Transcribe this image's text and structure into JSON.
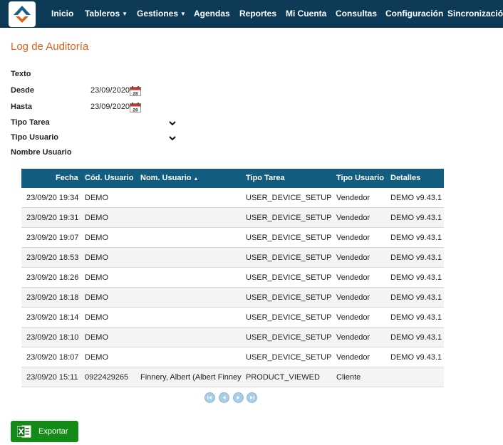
{
  "nav": {
    "items": [
      {
        "label": "Inicio",
        "dropdown": false
      },
      {
        "label": "Tableros",
        "dropdown": true
      },
      {
        "label": "Gestiones",
        "dropdown": true
      },
      {
        "label": "Agendas",
        "dropdown": false
      },
      {
        "label": "Reportes",
        "dropdown": false
      },
      {
        "label": "Mi Cuenta",
        "dropdown": false
      },
      {
        "label": "Consultas",
        "dropdown": false
      },
      {
        "label": "Configuración",
        "dropdown": false
      },
      {
        "label": "Sincronización",
        "dropdown": false
      }
    ],
    "caret": "▼",
    "bg_color": "#0d3a57"
  },
  "page": {
    "title": "Log de Auditoría"
  },
  "filters": {
    "texto_label": "Texto",
    "desde_label": "Desde",
    "desde_value": "23/09/2020",
    "hasta_label": "Hasta",
    "hasta_value": "23/09/2020",
    "tipo_tarea_label": "Tipo Tarea",
    "tipo_usuario_label": "Tipo Usuario",
    "nombre_usuario_label": "Nombre Usuario",
    "calendar_icon_day": "28"
  },
  "table": {
    "headers": {
      "fecha": "Fecha",
      "cod_usuario": "Cód. Usuario",
      "nom_usuario": "Nom. Usuario",
      "tipo_tarea": "Tipo Tarea",
      "tipo_usuario": "Tipo Usuario",
      "detalles": "Detalles"
    },
    "sort_indicator": "▲",
    "rows": [
      {
        "fecha": "23/09/20 19:34",
        "cod_usuario": "DEMO",
        "nom_usuario": "",
        "tipo_tarea": "USER_DEVICE_SETUP",
        "tipo_usuario": "Vendedor",
        "detalles": "DEMO v9.43.1"
      },
      {
        "fecha": "23/09/20 19:31",
        "cod_usuario": "DEMO",
        "nom_usuario": "",
        "tipo_tarea": "USER_DEVICE_SETUP",
        "tipo_usuario": "Vendedor",
        "detalles": "DEMO v9.43.1"
      },
      {
        "fecha": "23/09/20 19:07",
        "cod_usuario": "DEMO",
        "nom_usuario": "",
        "tipo_tarea": "USER_DEVICE_SETUP",
        "tipo_usuario": "Vendedor",
        "detalles": "DEMO v9.43.1"
      },
      {
        "fecha": "23/09/20 18:53",
        "cod_usuario": "DEMO",
        "nom_usuario": "",
        "tipo_tarea": "USER_DEVICE_SETUP",
        "tipo_usuario": "Vendedor",
        "detalles": "DEMO v9.43.1"
      },
      {
        "fecha": "23/09/20 18:26",
        "cod_usuario": "DEMO",
        "nom_usuario": "",
        "tipo_tarea": "USER_DEVICE_SETUP",
        "tipo_usuario": "Vendedor",
        "detalles": "DEMO v9.43.1"
      },
      {
        "fecha": "23/09/20 18:18",
        "cod_usuario": "DEMO",
        "nom_usuario": "",
        "tipo_tarea": "USER_DEVICE_SETUP",
        "tipo_usuario": "Vendedor",
        "detalles": "DEMO v9.43.1"
      },
      {
        "fecha": "23/09/20 18:14",
        "cod_usuario": "DEMO",
        "nom_usuario": "",
        "tipo_tarea": "USER_DEVICE_SETUP",
        "tipo_usuario": "Vendedor",
        "detalles": "DEMO v9.43.1"
      },
      {
        "fecha": "23/09/20 18:10",
        "cod_usuario": "DEMO",
        "nom_usuario": "",
        "tipo_tarea": "USER_DEVICE_SETUP",
        "tipo_usuario": "Vendedor",
        "detalles": "DEMO v9.43.1"
      },
      {
        "fecha": "23/09/20 18:07",
        "cod_usuario": "DEMO",
        "nom_usuario": "",
        "tipo_tarea": "USER_DEVICE_SETUP",
        "tipo_usuario": "Vendedor",
        "detalles": "DEMO v9.43.1"
      },
      {
        "fecha": "23/09/20 15:11",
        "cod_usuario": "0922429265",
        "nom_usuario": "Finnery, Albert (Albert Finney",
        "tipo_tarea": "PRODUCT_VIEWED",
        "tipo_usuario": "Cliente",
        "detalles": ""
      }
    ],
    "header_color": "#135e80"
  },
  "pager": {
    "buttons": [
      "first-page",
      "previous-page",
      "next-page",
      "last-page"
    ]
  },
  "export": {
    "label": "Exportar",
    "icon": "excel-icon",
    "color": "#148a17"
  },
  "colors": {
    "title": "#e0601c"
  }
}
